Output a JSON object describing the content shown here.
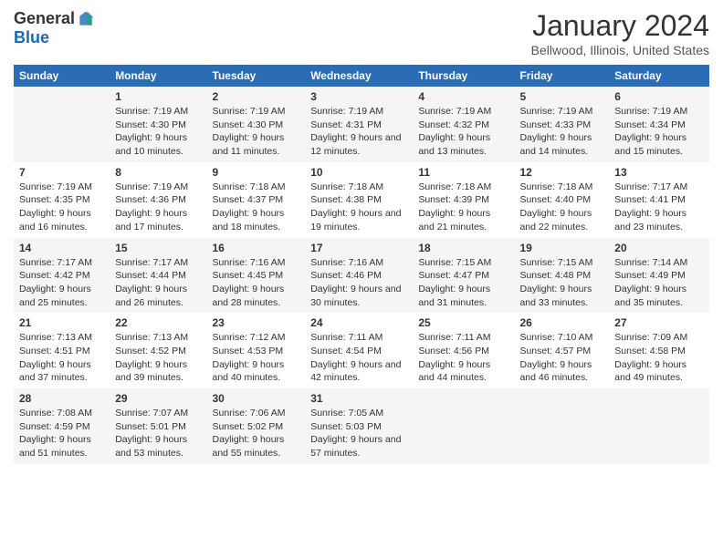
{
  "header": {
    "logo_general": "General",
    "logo_blue": "Blue",
    "month_title": "January 2024",
    "location": "Bellwood, Illinois, United States"
  },
  "weekdays": [
    "Sunday",
    "Monday",
    "Tuesday",
    "Wednesday",
    "Thursday",
    "Friday",
    "Saturday"
  ],
  "weeks": [
    [
      {
        "day": "",
        "sunrise": "",
        "sunset": "",
        "daylight": ""
      },
      {
        "day": "1",
        "sunrise": "Sunrise: 7:19 AM",
        "sunset": "Sunset: 4:30 PM",
        "daylight": "Daylight: 9 hours and 10 minutes."
      },
      {
        "day": "2",
        "sunrise": "Sunrise: 7:19 AM",
        "sunset": "Sunset: 4:30 PM",
        "daylight": "Daylight: 9 hours and 11 minutes."
      },
      {
        "day": "3",
        "sunrise": "Sunrise: 7:19 AM",
        "sunset": "Sunset: 4:31 PM",
        "daylight": "Daylight: 9 hours and 12 minutes."
      },
      {
        "day": "4",
        "sunrise": "Sunrise: 7:19 AM",
        "sunset": "Sunset: 4:32 PM",
        "daylight": "Daylight: 9 hours and 13 minutes."
      },
      {
        "day": "5",
        "sunrise": "Sunrise: 7:19 AM",
        "sunset": "Sunset: 4:33 PM",
        "daylight": "Daylight: 9 hours and 14 minutes."
      },
      {
        "day": "6",
        "sunrise": "Sunrise: 7:19 AM",
        "sunset": "Sunset: 4:34 PM",
        "daylight": "Daylight: 9 hours and 15 minutes."
      }
    ],
    [
      {
        "day": "7",
        "sunrise": "Sunrise: 7:19 AM",
        "sunset": "Sunset: 4:35 PM",
        "daylight": "Daylight: 9 hours and 16 minutes."
      },
      {
        "day": "8",
        "sunrise": "Sunrise: 7:19 AM",
        "sunset": "Sunset: 4:36 PM",
        "daylight": "Daylight: 9 hours and 17 minutes."
      },
      {
        "day": "9",
        "sunrise": "Sunrise: 7:18 AM",
        "sunset": "Sunset: 4:37 PM",
        "daylight": "Daylight: 9 hours and 18 minutes."
      },
      {
        "day": "10",
        "sunrise": "Sunrise: 7:18 AM",
        "sunset": "Sunset: 4:38 PM",
        "daylight": "Daylight: 9 hours and 19 minutes."
      },
      {
        "day": "11",
        "sunrise": "Sunrise: 7:18 AM",
        "sunset": "Sunset: 4:39 PM",
        "daylight": "Daylight: 9 hours and 21 minutes."
      },
      {
        "day": "12",
        "sunrise": "Sunrise: 7:18 AM",
        "sunset": "Sunset: 4:40 PM",
        "daylight": "Daylight: 9 hours and 22 minutes."
      },
      {
        "day": "13",
        "sunrise": "Sunrise: 7:17 AM",
        "sunset": "Sunset: 4:41 PM",
        "daylight": "Daylight: 9 hours and 23 minutes."
      }
    ],
    [
      {
        "day": "14",
        "sunrise": "Sunrise: 7:17 AM",
        "sunset": "Sunset: 4:42 PM",
        "daylight": "Daylight: 9 hours and 25 minutes."
      },
      {
        "day": "15",
        "sunrise": "Sunrise: 7:17 AM",
        "sunset": "Sunset: 4:44 PM",
        "daylight": "Daylight: 9 hours and 26 minutes."
      },
      {
        "day": "16",
        "sunrise": "Sunrise: 7:16 AM",
        "sunset": "Sunset: 4:45 PM",
        "daylight": "Daylight: 9 hours and 28 minutes."
      },
      {
        "day": "17",
        "sunrise": "Sunrise: 7:16 AM",
        "sunset": "Sunset: 4:46 PM",
        "daylight": "Daylight: 9 hours and 30 minutes."
      },
      {
        "day": "18",
        "sunrise": "Sunrise: 7:15 AM",
        "sunset": "Sunset: 4:47 PM",
        "daylight": "Daylight: 9 hours and 31 minutes."
      },
      {
        "day": "19",
        "sunrise": "Sunrise: 7:15 AM",
        "sunset": "Sunset: 4:48 PM",
        "daylight": "Daylight: 9 hours and 33 minutes."
      },
      {
        "day": "20",
        "sunrise": "Sunrise: 7:14 AM",
        "sunset": "Sunset: 4:49 PM",
        "daylight": "Daylight: 9 hours and 35 minutes."
      }
    ],
    [
      {
        "day": "21",
        "sunrise": "Sunrise: 7:13 AM",
        "sunset": "Sunset: 4:51 PM",
        "daylight": "Daylight: 9 hours and 37 minutes."
      },
      {
        "day": "22",
        "sunrise": "Sunrise: 7:13 AM",
        "sunset": "Sunset: 4:52 PM",
        "daylight": "Daylight: 9 hours and 39 minutes."
      },
      {
        "day": "23",
        "sunrise": "Sunrise: 7:12 AM",
        "sunset": "Sunset: 4:53 PM",
        "daylight": "Daylight: 9 hours and 40 minutes."
      },
      {
        "day": "24",
        "sunrise": "Sunrise: 7:11 AM",
        "sunset": "Sunset: 4:54 PM",
        "daylight": "Daylight: 9 hours and 42 minutes."
      },
      {
        "day": "25",
        "sunrise": "Sunrise: 7:11 AM",
        "sunset": "Sunset: 4:56 PM",
        "daylight": "Daylight: 9 hours and 44 minutes."
      },
      {
        "day": "26",
        "sunrise": "Sunrise: 7:10 AM",
        "sunset": "Sunset: 4:57 PM",
        "daylight": "Daylight: 9 hours and 46 minutes."
      },
      {
        "day": "27",
        "sunrise": "Sunrise: 7:09 AM",
        "sunset": "Sunset: 4:58 PM",
        "daylight": "Daylight: 9 hours and 49 minutes."
      }
    ],
    [
      {
        "day": "28",
        "sunrise": "Sunrise: 7:08 AM",
        "sunset": "Sunset: 4:59 PM",
        "daylight": "Daylight: 9 hours and 51 minutes."
      },
      {
        "day": "29",
        "sunrise": "Sunrise: 7:07 AM",
        "sunset": "Sunset: 5:01 PM",
        "daylight": "Daylight: 9 hours and 53 minutes."
      },
      {
        "day": "30",
        "sunrise": "Sunrise: 7:06 AM",
        "sunset": "Sunset: 5:02 PM",
        "daylight": "Daylight: 9 hours and 55 minutes."
      },
      {
        "day": "31",
        "sunrise": "Sunrise: 7:05 AM",
        "sunset": "Sunset: 5:03 PM",
        "daylight": "Daylight: 9 hours and 57 minutes."
      },
      {
        "day": "",
        "sunrise": "",
        "sunset": "",
        "daylight": ""
      },
      {
        "day": "",
        "sunrise": "",
        "sunset": "",
        "daylight": ""
      },
      {
        "day": "",
        "sunrise": "",
        "sunset": "",
        "daylight": ""
      }
    ]
  ]
}
